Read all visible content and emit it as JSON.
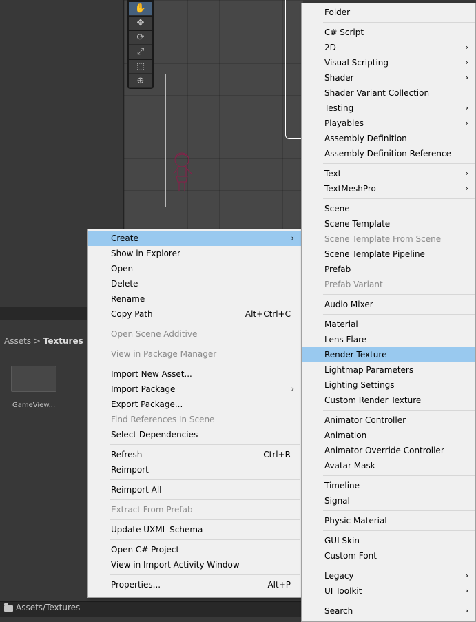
{
  "breadcrumb": {
    "root": "Assets",
    "separator": ">",
    "current": "Textures"
  },
  "asset": {
    "name": "GameView..."
  },
  "status_bar": {
    "path": "Assets/Textures"
  },
  "context_menu": [
    {
      "label": "Create",
      "arrow": "›",
      "highlight": true
    },
    {
      "label": "Show in Explorer"
    },
    {
      "label": "Open"
    },
    {
      "label": "Delete"
    },
    {
      "label": "Rename"
    },
    {
      "label": "Copy Path",
      "shortcut": "Alt+Ctrl+C"
    },
    {
      "sep": true
    },
    {
      "label": "Open Scene Additive",
      "disabled": true
    },
    {
      "sep": true
    },
    {
      "label": "View in Package Manager",
      "disabled": true
    },
    {
      "sep": true
    },
    {
      "label": "Import New Asset..."
    },
    {
      "label": "Import Package",
      "arrow": "›"
    },
    {
      "label": "Export Package..."
    },
    {
      "label": "Find References In Scene",
      "disabled": true
    },
    {
      "label": "Select Dependencies"
    },
    {
      "sep": true
    },
    {
      "label": "Refresh",
      "shortcut": "Ctrl+R"
    },
    {
      "label": "Reimport"
    },
    {
      "sep": true
    },
    {
      "label": "Reimport All"
    },
    {
      "sep": true
    },
    {
      "label": "Extract From Prefab",
      "disabled": true
    },
    {
      "sep": true
    },
    {
      "label": "Update UXML Schema"
    },
    {
      "sep": true
    },
    {
      "label": "Open C# Project"
    },
    {
      "label": "View in Import Activity Window"
    },
    {
      "sep": true
    },
    {
      "label": "Properties...",
      "shortcut": "Alt+P"
    }
  ],
  "create_menu": [
    {
      "label": "Folder"
    },
    {
      "sep": true
    },
    {
      "label": "C# Script"
    },
    {
      "label": "2D",
      "arrow": "›"
    },
    {
      "label": "Visual Scripting",
      "arrow": "›"
    },
    {
      "label": "Shader",
      "arrow": "›"
    },
    {
      "label": "Shader Variant Collection"
    },
    {
      "label": "Testing",
      "arrow": "›"
    },
    {
      "label": "Playables",
      "arrow": "›"
    },
    {
      "label": "Assembly Definition"
    },
    {
      "label": "Assembly Definition Reference"
    },
    {
      "sep": true
    },
    {
      "label": "Text",
      "arrow": "›"
    },
    {
      "label": "TextMeshPro",
      "arrow": "›"
    },
    {
      "sep": true
    },
    {
      "label": "Scene"
    },
    {
      "label": "Scene Template"
    },
    {
      "label": "Scene Template From Scene",
      "disabled": true
    },
    {
      "label": "Scene Template Pipeline"
    },
    {
      "label": "Prefab"
    },
    {
      "label": "Prefab Variant",
      "disabled": true
    },
    {
      "sep": true
    },
    {
      "label": "Audio Mixer"
    },
    {
      "sep": true
    },
    {
      "label": "Material"
    },
    {
      "label": "Lens Flare"
    },
    {
      "label": "Render Texture",
      "highlight": true
    },
    {
      "label": "Lightmap Parameters"
    },
    {
      "label": "Lighting Settings"
    },
    {
      "label": "Custom Render Texture"
    },
    {
      "sep": true
    },
    {
      "label": "Animator Controller"
    },
    {
      "label": "Animation"
    },
    {
      "label": "Animator Override Controller"
    },
    {
      "label": "Avatar Mask"
    },
    {
      "sep": true
    },
    {
      "label": "Timeline"
    },
    {
      "label": "Signal"
    },
    {
      "sep": true
    },
    {
      "label": "Physic Material"
    },
    {
      "sep": true
    },
    {
      "label": "GUI Skin"
    },
    {
      "label": "Custom Font"
    },
    {
      "sep": true
    },
    {
      "label": "Legacy",
      "arrow": "›"
    },
    {
      "label": "UI Toolkit",
      "arrow": "›"
    },
    {
      "sep": true
    },
    {
      "label": "Search",
      "arrow": "›"
    }
  ],
  "tools": [
    {
      "icon": "hand-icon",
      "glyph": "✋",
      "active": true
    },
    {
      "icon": "move-icon",
      "glyph": "✥"
    },
    {
      "icon": "rotate-icon",
      "glyph": "⟳"
    },
    {
      "icon": "scale-icon",
      "glyph": "⤢"
    },
    {
      "icon": "rect-icon",
      "glyph": "⬚"
    },
    {
      "icon": "transform-icon",
      "glyph": "⊕"
    }
  ]
}
